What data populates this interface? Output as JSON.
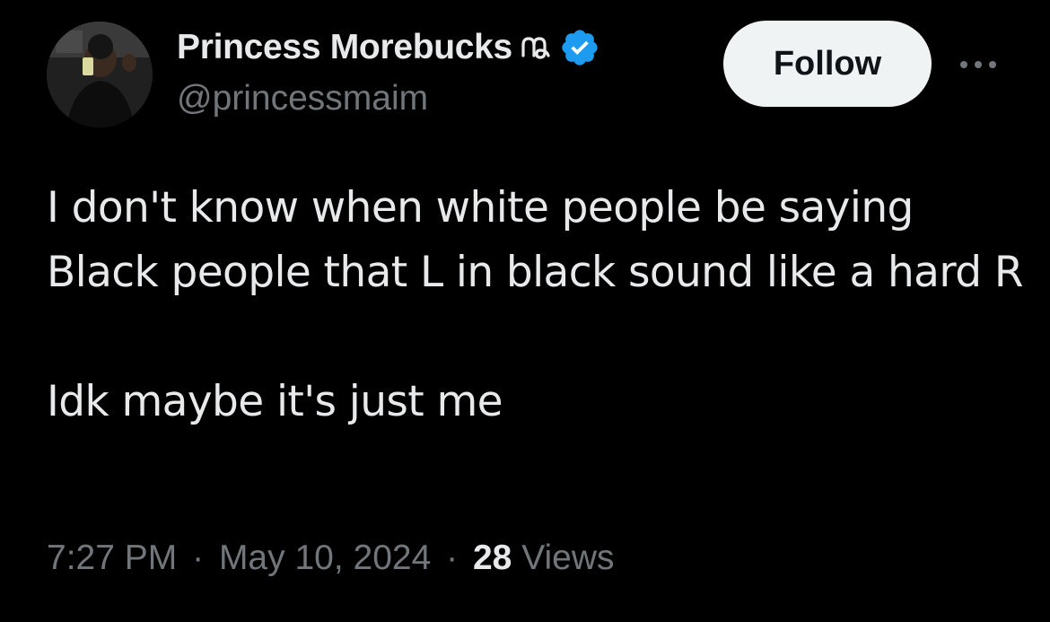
{
  "user": {
    "display_name": "Princess Morebucks",
    "handle": "@princessmaim",
    "emoji_icon": "capricorn-icon",
    "verified_icon": "verified-badge-icon",
    "avatar_icon": "avatar-photo"
  },
  "actions": {
    "follow_label": "Follow",
    "more_icon": "more-options-icon"
  },
  "tweet": {
    "paragraph_1": "I don't know when white people be saying Black people that L in black sound like a hard R",
    "paragraph_2": "Idk maybe it's just me"
  },
  "meta": {
    "time": "7:27 PM",
    "separator": "·",
    "date": "May 10, 2024",
    "views_count": "28",
    "views_label": "Views"
  },
  "colors": {
    "background": "#000000",
    "text_primary": "#e7e9ea",
    "text_secondary": "#71767b",
    "verified_blue": "#1d9bf0",
    "follow_bg": "#eff3f4"
  }
}
